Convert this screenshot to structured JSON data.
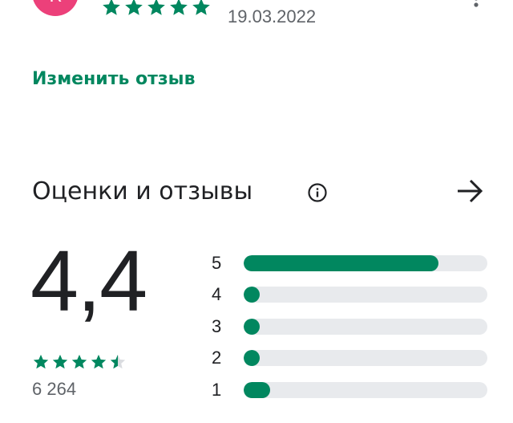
{
  "review": {
    "avatar_letter": "К",
    "rating": 5,
    "date": "19.03.2022"
  },
  "edit_review_label": "Изменить отзыв",
  "ratings_section": {
    "title": "Оценки и отзывы",
    "average": "4,4",
    "average_stars": 4.5,
    "count": "6 264",
    "distribution": [
      {
        "label": "5",
        "fraction": 0.8
      },
      {
        "label": "4",
        "fraction": 0.06
      },
      {
        "label": "3",
        "fraction": 0.06
      },
      {
        "label": "2",
        "fraction": 0.06
      },
      {
        "label": "1",
        "fraction": 0.11
      }
    ]
  },
  "icons": {
    "more": "more-vert-icon",
    "info": "info-icon",
    "arrow": "arrow-right-icon",
    "star": "star-icon"
  },
  "colors": {
    "accent": "#01875f",
    "track": "#e8eaed",
    "avatar": "#ec407a"
  }
}
